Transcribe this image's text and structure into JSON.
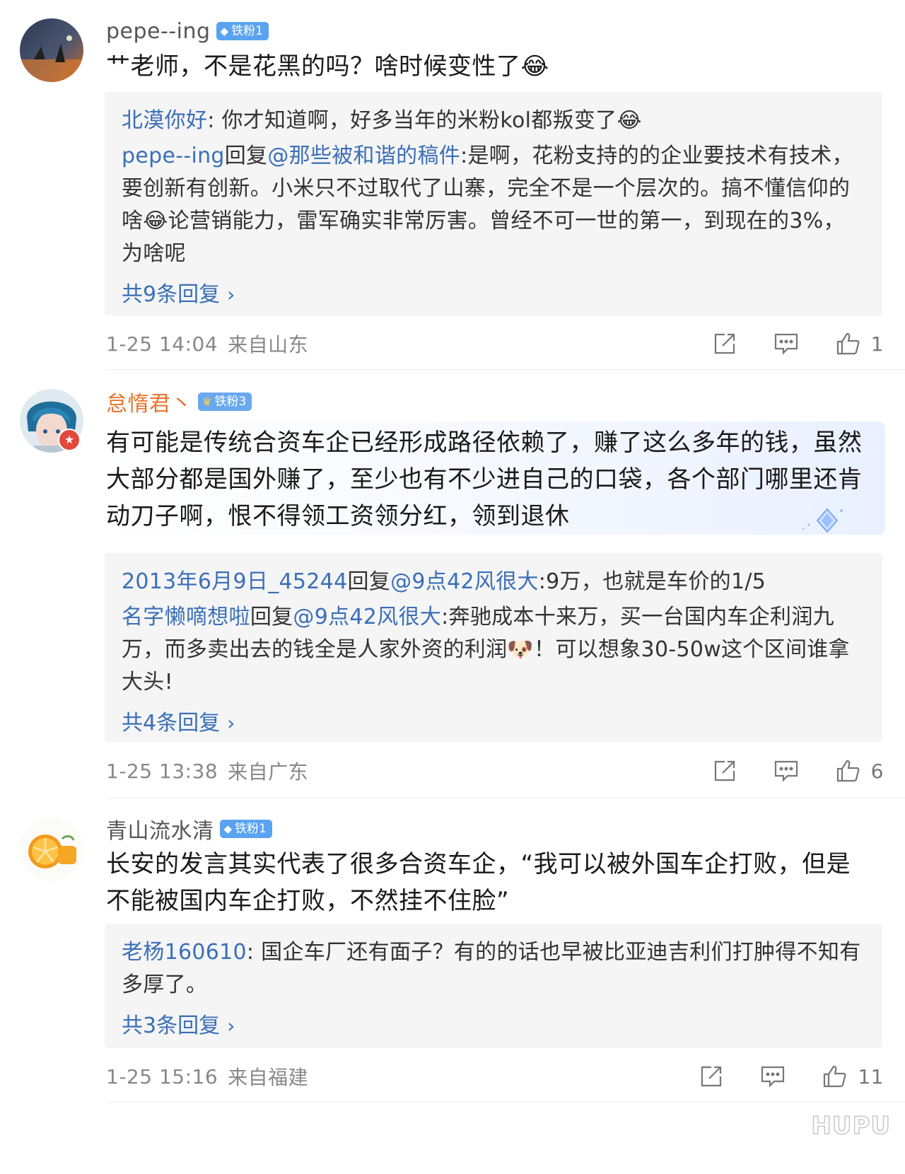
{
  "comments": [
    {
      "username": "pepe--ing",
      "badge": "铁粉1",
      "text": "艹老师，不是花黑的吗？啥时候变性了😂",
      "replies": [
        {
          "name": "北漠你好",
          "sep": ": ",
          "text": "你才知道啊，好多当年的米粉kol都叛变了😂"
        },
        {
          "name": "pepe--ing",
          "reply_word": "回复",
          "target": "@那些被和谐的稿件",
          "sep": ":",
          "text": "是啊，花粉支持的的企业要技术有技术，要创新有创新。小米只不过取代了山寨，完全不是一个层次的。搞不懂信仰的啥😂论营销能力，雷军确实非常厉害。曾经不可一世的第一，到现在的3%，为啥呢"
        }
      ],
      "more_replies": "共9条回复",
      "time": "1-25 14:04",
      "location": "来自山东",
      "likes": "1"
    },
    {
      "username": "怠惰君丶",
      "badge": "铁粉3",
      "text": "有可能是传统合资车企已经形成路径依赖了，赚了这么多年的钱，虽然大部分都是国外赚了，至少也有不少进自己的口袋，各个部门哪里还肯动刀子啊，恨不得领工资领分红，领到退休",
      "replies": [
        {
          "name": "2013年6月9日_45244",
          "reply_word": "回复",
          "target": "@9点42风很大",
          "sep": ":",
          "text": "9万，也就是车价的1/5"
        },
        {
          "name": "名字懒嘀想啦",
          "reply_word": "回复",
          "target": "@9点42风很大",
          "sep": ":",
          "text": "奔驰成本十来万，买一台国内车企利润九万，而多卖出去的钱全是人家外资的利润🐶！可以想象30-50w这个区间谁拿大头!"
        }
      ],
      "more_replies": "共4条回复",
      "time": "1-25 13:38",
      "location": "来自广东",
      "likes": "6"
    },
    {
      "username": "青山流水清",
      "badge": "铁粉1",
      "text": "长安的发言其实代表了很多合资车企，“我可以被外国车企打败，但是不能被国内车企打败，不然挂不住脸”",
      "replies": [
        {
          "name": "老杨160610",
          "sep": ": ",
          "text": "国企车厂还有面子？有的的话也早被比亚迪吉利们打肿得不知有多厚了。"
        }
      ],
      "more_replies": "共3条回复",
      "time": "1-25 15:16",
      "location": "来自福建",
      "likes": "11"
    }
  ],
  "watermark": "HUPU",
  "icons": [
    "share-icon",
    "comment-icon",
    "thumbs-up-icon",
    "chevron-right-icon",
    "diamond-badge-icon",
    "crown-badge-icon"
  ]
}
